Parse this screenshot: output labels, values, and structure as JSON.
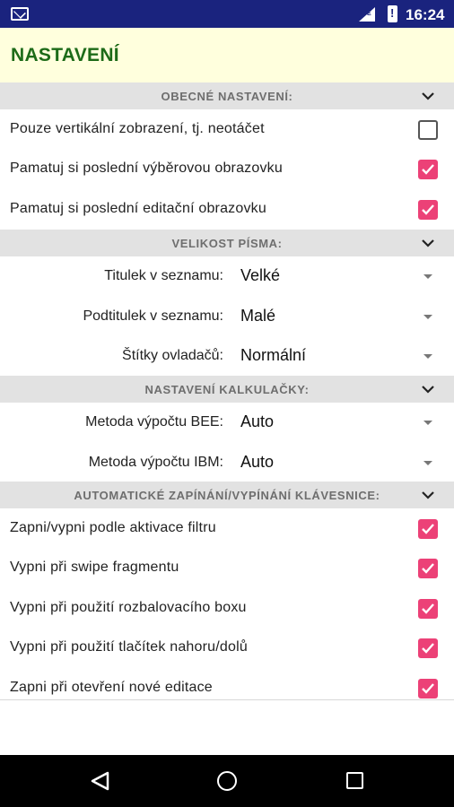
{
  "status_bar": {
    "time": "16:24",
    "icons": [
      "mail-icon",
      "signal-icon",
      "battery-icon"
    ]
  },
  "app_bar": {
    "title": "NASTAVENÍ"
  },
  "sections": [
    {
      "title": "OBECNÉ NASTAVENÍ:",
      "checkbox_items": [
        {
          "label": "Pouze vertikální zobrazení, tj. neotáčet",
          "checked": false
        },
        {
          "label": "Pamatuj si poslední výběrovou obrazovku",
          "checked": true
        },
        {
          "label": "Pamatuj si poslední editační obrazovku",
          "checked": true
        }
      ]
    },
    {
      "title": "VELIKOST PÍSMA:",
      "select_items": [
        {
          "label": "Titulek v seznamu:",
          "value": "Velké"
        },
        {
          "label": "Podtitulek v seznamu:",
          "value": "Malé"
        },
        {
          "label": "Štítky ovladačů:",
          "value": "Normální"
        }
      ]
    },
    {
      "title": "NASTAVENÍ KALKULAČKY:",
      "select_items": [
        {
          "label": "Metoda výpočtu BEE:",
          "value": "Auto"
        },
        {
          "label": "Metoda výpočtu IBM:",
          "value": "Auto"
        }
      ]
    },
    {
      "title": "AUTOMATICKÉ ZAPÍNÁNÍ/VYPÍNÁNÍ KLÁVESNICE:",
      "checkbox_items": [
        {
          "label": "Zapni/vypni podle aktivace filtru",
          "checked": true
        },
        {
          "label": "Vypni při swipe fragmentu",
          "checked": true
        },
        {
          "label": "Vypni při použití rozbalovacího boxu",
          "checked": true
        },
        {
          "label": "Vypni při použití tlačítek nahoru/dolů",
          "checked": true
        },
        {
          "label": "Zapni při otevření nové editace",
          "checked": true
        }
      ]
    }
  ],
  "colors": {
    "status_bar": "#1a237e",
    "app_bar": "#ffffdd",
    "title": "#1d6b18",
    "checkbox_on": "#ec4177",
    "section_bg": "#e2e2e2"
  },
  "nav_bar": {
    "icons": [
      "back-icon",
      "home-icon",
      "recent-apps-icon"
    ]
  }
}
